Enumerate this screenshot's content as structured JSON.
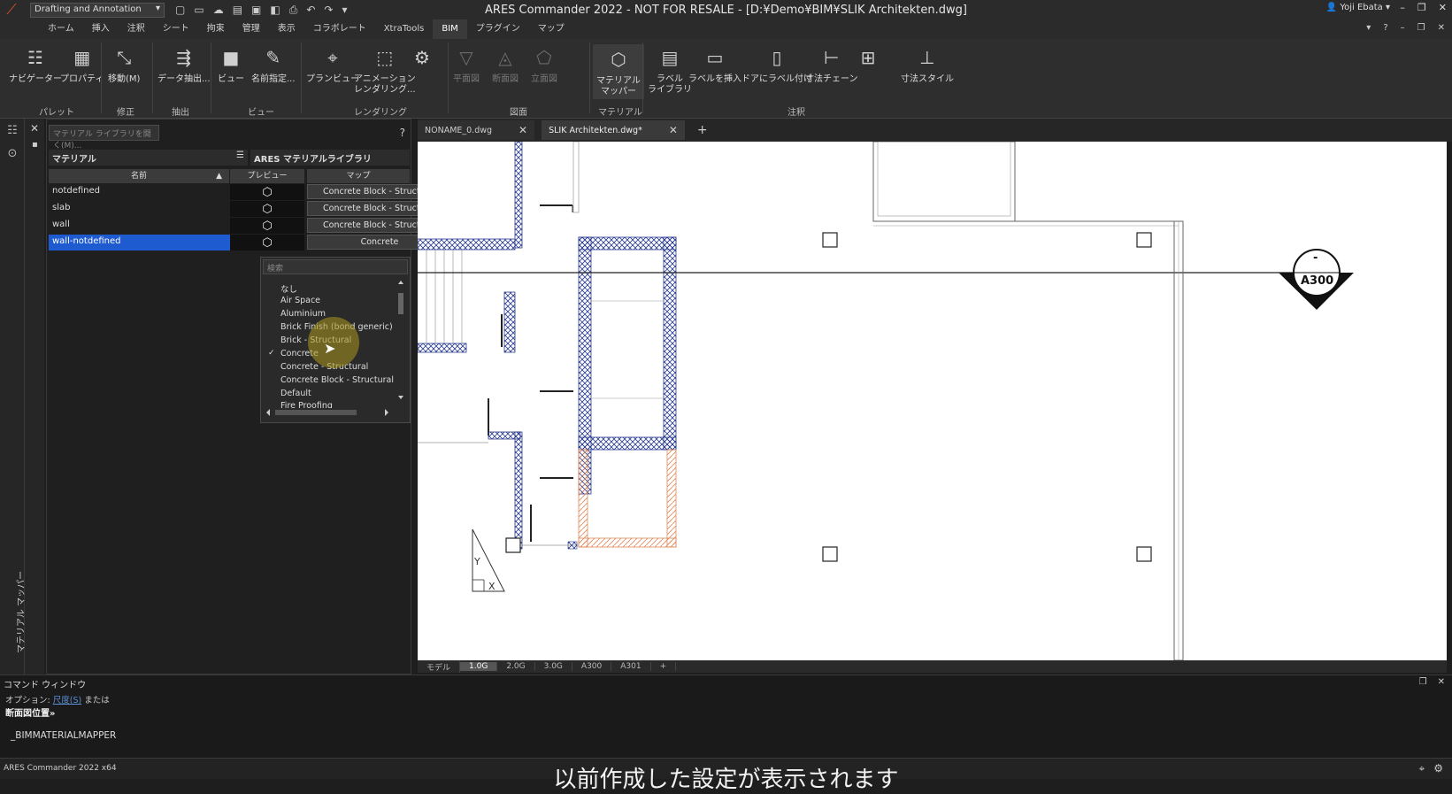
{
  "titlebar": {
    "workspace": "Drafting and Annotation",
    "window_title": "ARES Commander 2022 - NOT FOR RESALE - [D:¥Demo¥BIM¥SLIK Architekten.dwg]",
    "user": "Yoji Ebata"
  },
  "menu": {
    "tabs": [
      "ホーム",
      "挿入",
      "注釈",
      "シート",
      "拘束",
      "管理",
      "表示",
      "コラボレート",
      "XtraTools",
      "BIM",
      "プラグイン",
      "マップ"
    ],
    "active": "BIM"
  },
  "ribbon": {
    "buttons": {
      "navigator": "ナビゲーター",
      "properties": "プロパティ",
      "move": "移動(M)",
      "data_extract": "データ抽出...",
      "view": "ビュー",
      "named": "名前指定...",
      "plan_view": "プランビュー",
      "animation": "アニメーション\nレンダリング...",
      "plan": "平面図",
      "section": "断面図",
      "elevation": "立面図",
      "material_mapper": "マテリアル\nマッパー",
      "label_library": "ラベル\nライブラリ",
      "insert_label": "ラベルを挿入",
      "label_door": "ドアにラベル付け",
      "dim_chain": "寸法チェーン",
      "dim_style": "寸法スタイル"
    },
    "groups": {
      "palette": "パレット",
      "modify": "修正",
      "extract": "抽出",
      "view": "ビュー",
      "render": "レンダリング",
      "drawing": "図面",
      "material": "マテリアル",
      "annotation": "注釈"
    }
  },
  "side_panel_label": "マテリアル マッパー",
  "material_panel": {
    "search_placeholder": "マテリアル ライブラリを開く(M)...",
    "help": "?",
    "left_header": "マテリアル",
    "right_header": "ARES マテリアルライブラリ",
    "columns": {
      "name": "名前",
      "preview": "プレビュー",
      "map": "マップ"
    },
    "rows": [
      {
        "name": "notdefined",
        "map": "Concrete Block - Structural"
      },
      {
        "name": "slab",
        "map": "Concrete Block - Structural"
      },
      {
        "name": "wall",
        "map": "Concrete Block - Structural"
      },
      {
        "name": "wall-notdefined",
        "map": "Concrete"
      }
    ],
    "dropdown": {
      "search_placeholder": "検索",
      "items": [
        "なし",
        "Air Space",
        "Aluminium",
        "Brick Finish (bond generic)",
        "Brick - Structural",
        "Concrete",
        "Concrete - Structural",
        "Concrete Block - Structural",
        "Default",
        "Fire Proofing"
      ],
      "checked": "Concrete"
    }
  },
  "doc_tabs": [
    "NONAME_0.dwg",
    "SLIK Architekten.dwg*"
  ],
  "drawing": {
    "section_mark": "A300",
    "section_dash": "-"
  },
  "sheet_tabs": [
    "モデル",
    "1.0G",
    "2.0G",
    "3.0G",
    "A300",
    "A301"
  ],
  "sheet_active": "1.0G",
  "command": {
    "title": "コマンド ウィンドウ",
    "line1_prefix": "オプション: ",
    "line1_option": "尺度(S)",
    "line1_suffix": " または",
    "line2": "断面図位置»",
    "line3": "_BIMMATERIALMAPPER"
  },
  "status": {
    "app": "ARES Commander 2022 x64"
  },
  "subtitle": "以前作成した設定が表示されます"
}
